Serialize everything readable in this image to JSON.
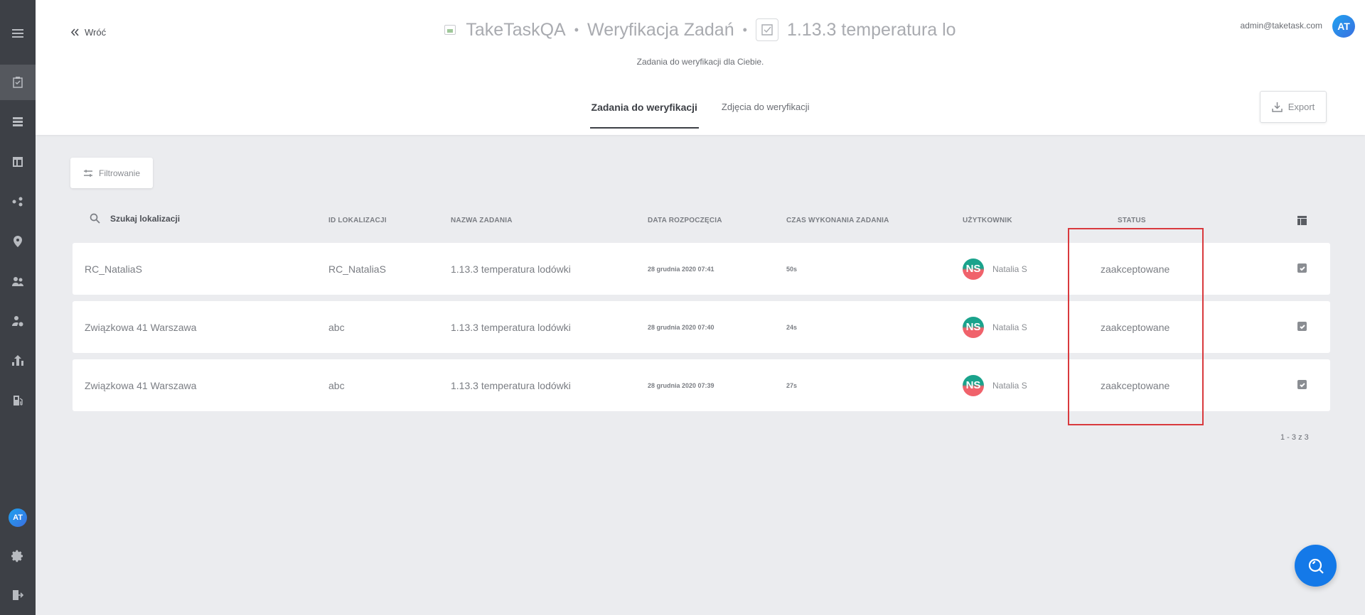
{
  "header": {
    "back_label": "Wróć",
    "breadcrumb": [
      "TakeTaskQA",
      "Weryfikacja Zadań",
      "1.13.3 temperatura lo"
    ],
    "subtitle": "Zadania do weryfikacji dla Ciebie.",
    "user_email": "admin@taketask.com",
    "user_initials": "AT",
    "export_label": "Export"
  },
  "tabs": [
    {
      "label": "Zadania do weryfikacji",
      "active": true
    },
    {
      "label": "Zdjęcia do weryfikacji",
      "active": false
    }
  ],
  "filter_label": "Filtrowanie",
  "table": {
    "search_placeholder": "Szukaj lokalizacji",
    "headers": [
      "ID LOKALIZACJI",
      "NAZWA ZADANIA",
      "DATA ROZPOCZĘCIA",
      "CZAS WYKONANIA ZADANIA",
      "UŻYTKOWNIK",
      "STATUS"
    ],
    "rows": [
      {
        "location": "RC_NataliaS",
        "location_id": "RC_NataliaS",
        "task": "1.13.3 temperatura lodówki",
        "start": "28 grudnia 2020 07:41",
        "duration": "50s",
        "user_initials": "NS",
        "user": "Natalia S",
        "status": "zaakceptowane"
      },
      {
        "location": "Związkowa 41 Warszawa",
        "location_id": "abc",
        "task": "1.13.3 temperatura lodówki",
        "start": "28 grudnia 2020 07:40",
        "duration": "24s",
        "user_initials": "NS",
        "user": "Natalia S",
        "status": "zaakceptowane"
      },
      {
        "location": "Związkowa 41 Warszawa",
        "location_id": "abc",
        "task": "1.13.3 temperatura lodówki",
        "start": "28 grudnia 2020 07:39",
        "duration": "27s",
        "user_initials": "NS",
        "user": "Natalia S",
        "status": "zaakceptowane"
      }
    ],
    "pagination": "1 - 3 z 3"
  },
  "sidebar": {
    "items": [
      "menu-icon",
      "tasks-icon",
      "list-icon",
      "layout-icon",
      "process-icon",
      "location-icon",
      "users-icon",
      "user-settings-icon",
      "chart-icon",
      "fuel-icon"
    ],
    "avatar_initials": "AT",
    "bottom": [
      "gear-icon",
      "logout-icon"
    ]
  },
  "colors": {
    "accent": "#1479e8",
    "highlight": "#d9393d",
    "sidebar": "#3d4046"
  }
}
